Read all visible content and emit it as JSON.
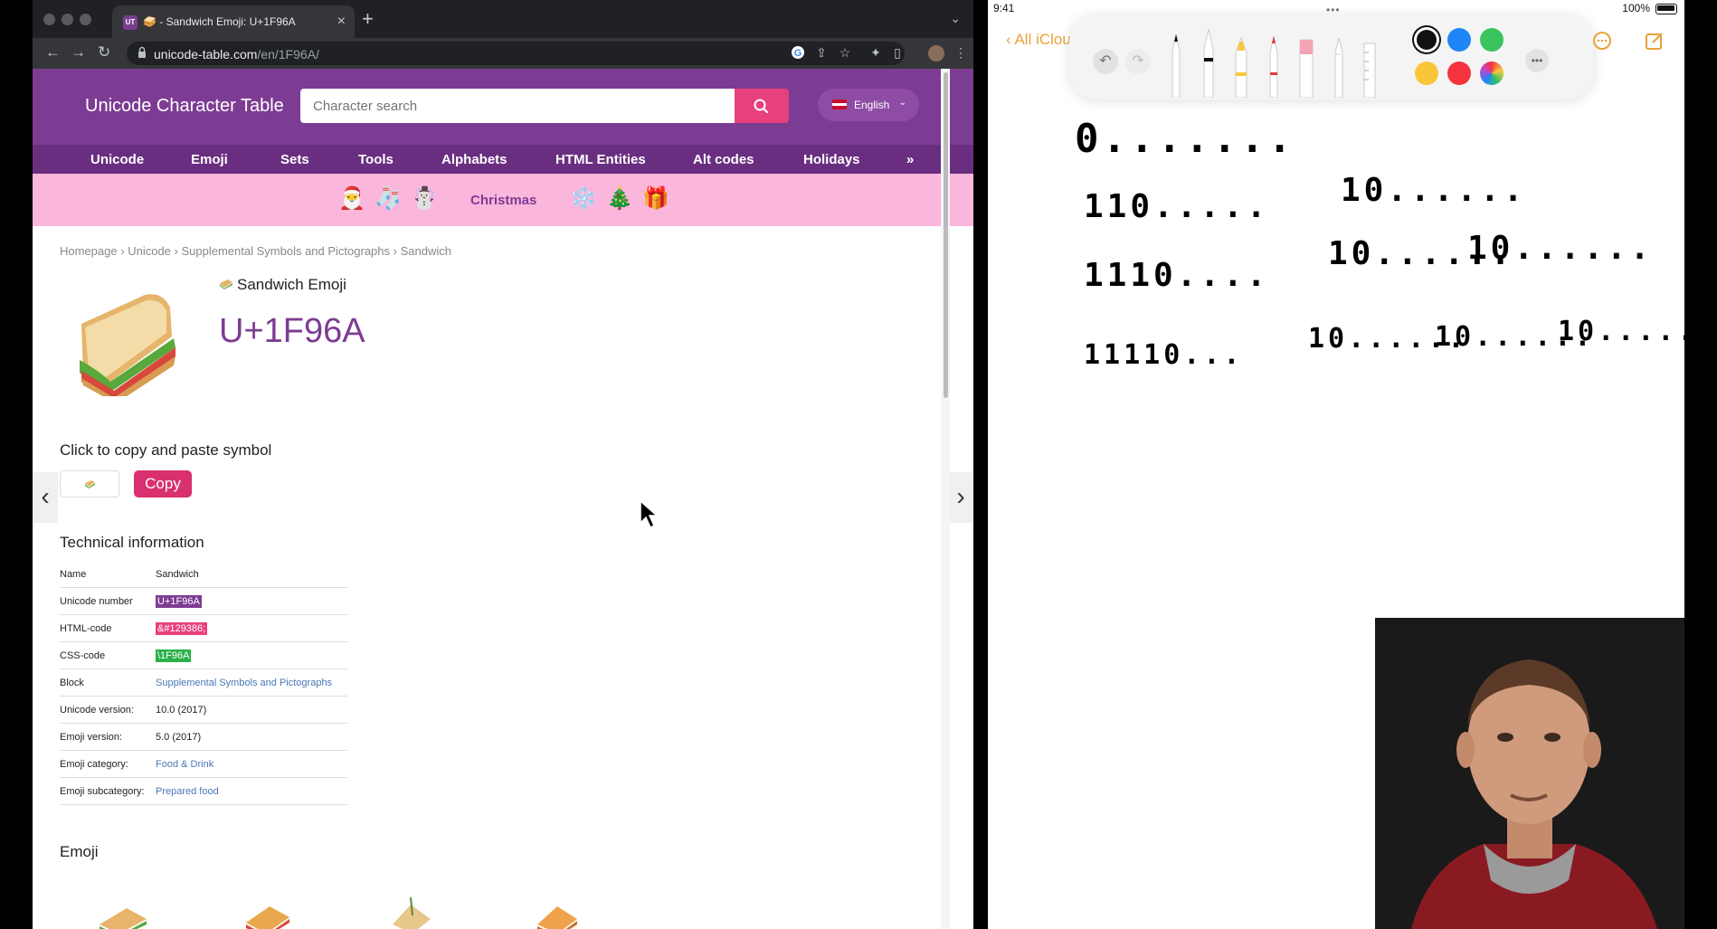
{
  "browser": {
    "tab": {
      "favicon_text": "UT",
      "title": "🥪 - Sandwich Emoji: U+1F96A"
    },
    "address_bar": {
      "host": "unicode-table.com",
      "path": "/en/1F96A/"
    }
  },
  "site": {
    "title": "Unicode Character Table",
    "search": {
      "placeholder": "Character search"
    },
    "language": "English",
    "nav": [
      "Unicode",
      "Emoji",
      "Sets",
      "Tools",
      "Alphabets",
      "HTML Entities",
      "Alt codes",
      "Holidays",
      "»"
    ],
    "holiday": {
      "label": "Christmas",
      "emojis_left": [
        "🎅",
        "🧦",
        "☃️"
      ],
      "emojis_right": [
        "❄️",
        "🎄",
        "🎁"
      ]
    },
    "breadcrumb": [
      "Homepage",
      "Unicode",
      "Supplemental Symbols and Pictographs",
      "Sandwich"
    ],
    "breadcrumb_separator": "›",
    "heading": "Sandwich Emoji",
    "code": "U+1F96A",
    "copy": {
      "heading": "Click to copy and paste symbol",
      "button": "Copy"
    },
    "technical": {
      "heading": "Technical information",
      "rows": [
        {
          "key": "Name",
          "value": "Sandwich"
        },
        {
          "key": "Unicode number",
          "value": "U+1F96A"
        },
        {
          "key": "HTML-code",
          "value": "&#129386;"
        },
        {
          "key": "CSS-code",
          "value": "\\1F96A"
        },
        {
          "key": "Block",
          "value": "Supplemental Symbols and Pictographs"
        },
        {
          "key": "Unicode version:",
          "value": "10.0 (2017)"
        },
        {
          "key": "Emoji version:",
          "value": "5.0 (2017)"
        },
        {
          "key": "Emoji category:",
          "value": "Food & Drink"
        },
        {
          "key": "Emoji subcategory:",
          "value": "Prepared food"
        }
      ]
    },
    "emoji_section_heading": "Emoji",
    "colors": {
      "header": "#7d3c93",
      "nav": "#6a2e80",
      "accent": "#e8407d",
      "holiday": "#fbb6dc"
    }
  },
  "ipad": {
    "time": "9:41",
    "battery": "100%",
    "back_label": "All iClou",
    "swatches": [
      "#111111",
      "#1f86f7",
      "#3ac45e",
      "#f9c63a",
      "#f5333f",
      "multicolor"
    ],
    "handwriting": [
      "0.......",
      "110.....",
      "10......",
      "1110....",
      "10......",
      "10......",
      "11110...",
      "10......",
      "10......",
      "10......"
    ]
  }
}
